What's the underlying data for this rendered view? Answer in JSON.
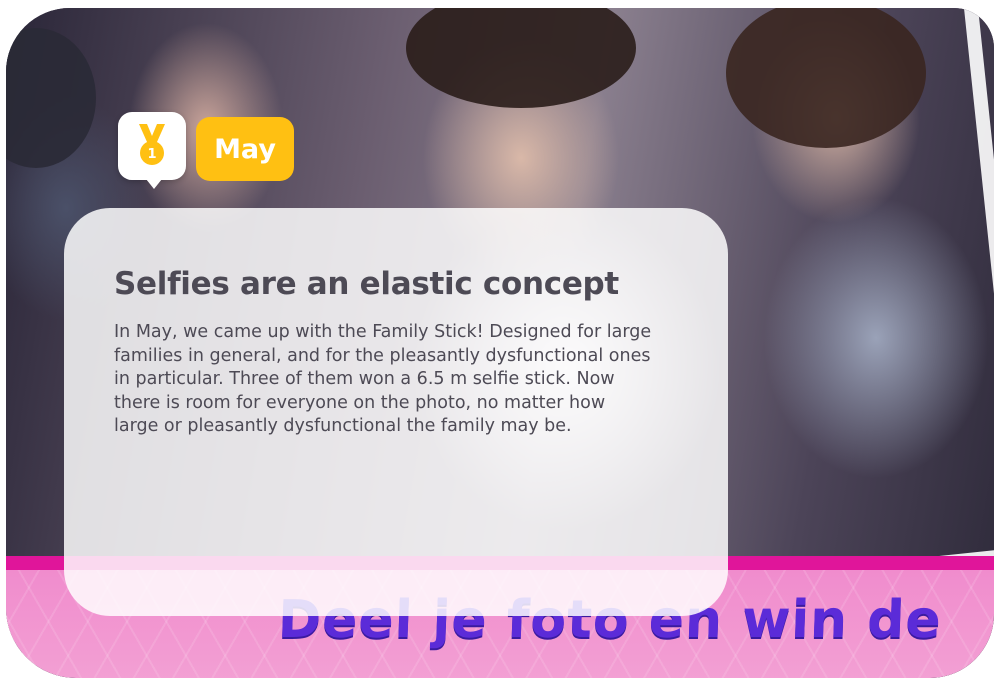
{
  "badge": {
    "medal_icon": "medal-icon",
    "medal_number": "1",
    "month": "May"
  },
  "card": {
    "title": "Selfies are an elastic concept",
    "body": "In May, we came up with the Family Stick! Designed for large families in general, and for the pleasantly dysfunctional ones in particular. Three of them won a 6.5 m selfie stick. Now there is room for everyone on the photo, no matter how large or pleasantly dysfunctional the family may be."
  },
  "banner": {
    "text": "Deel je foto en win de"
  },
  "colors": {
    "badge_yellow": "#ffc012",
    "text_gray": "#4d4a55",
    "banner_pink": "#e0159a",
    "banner_text": "#5b2bd8"
  }
}
